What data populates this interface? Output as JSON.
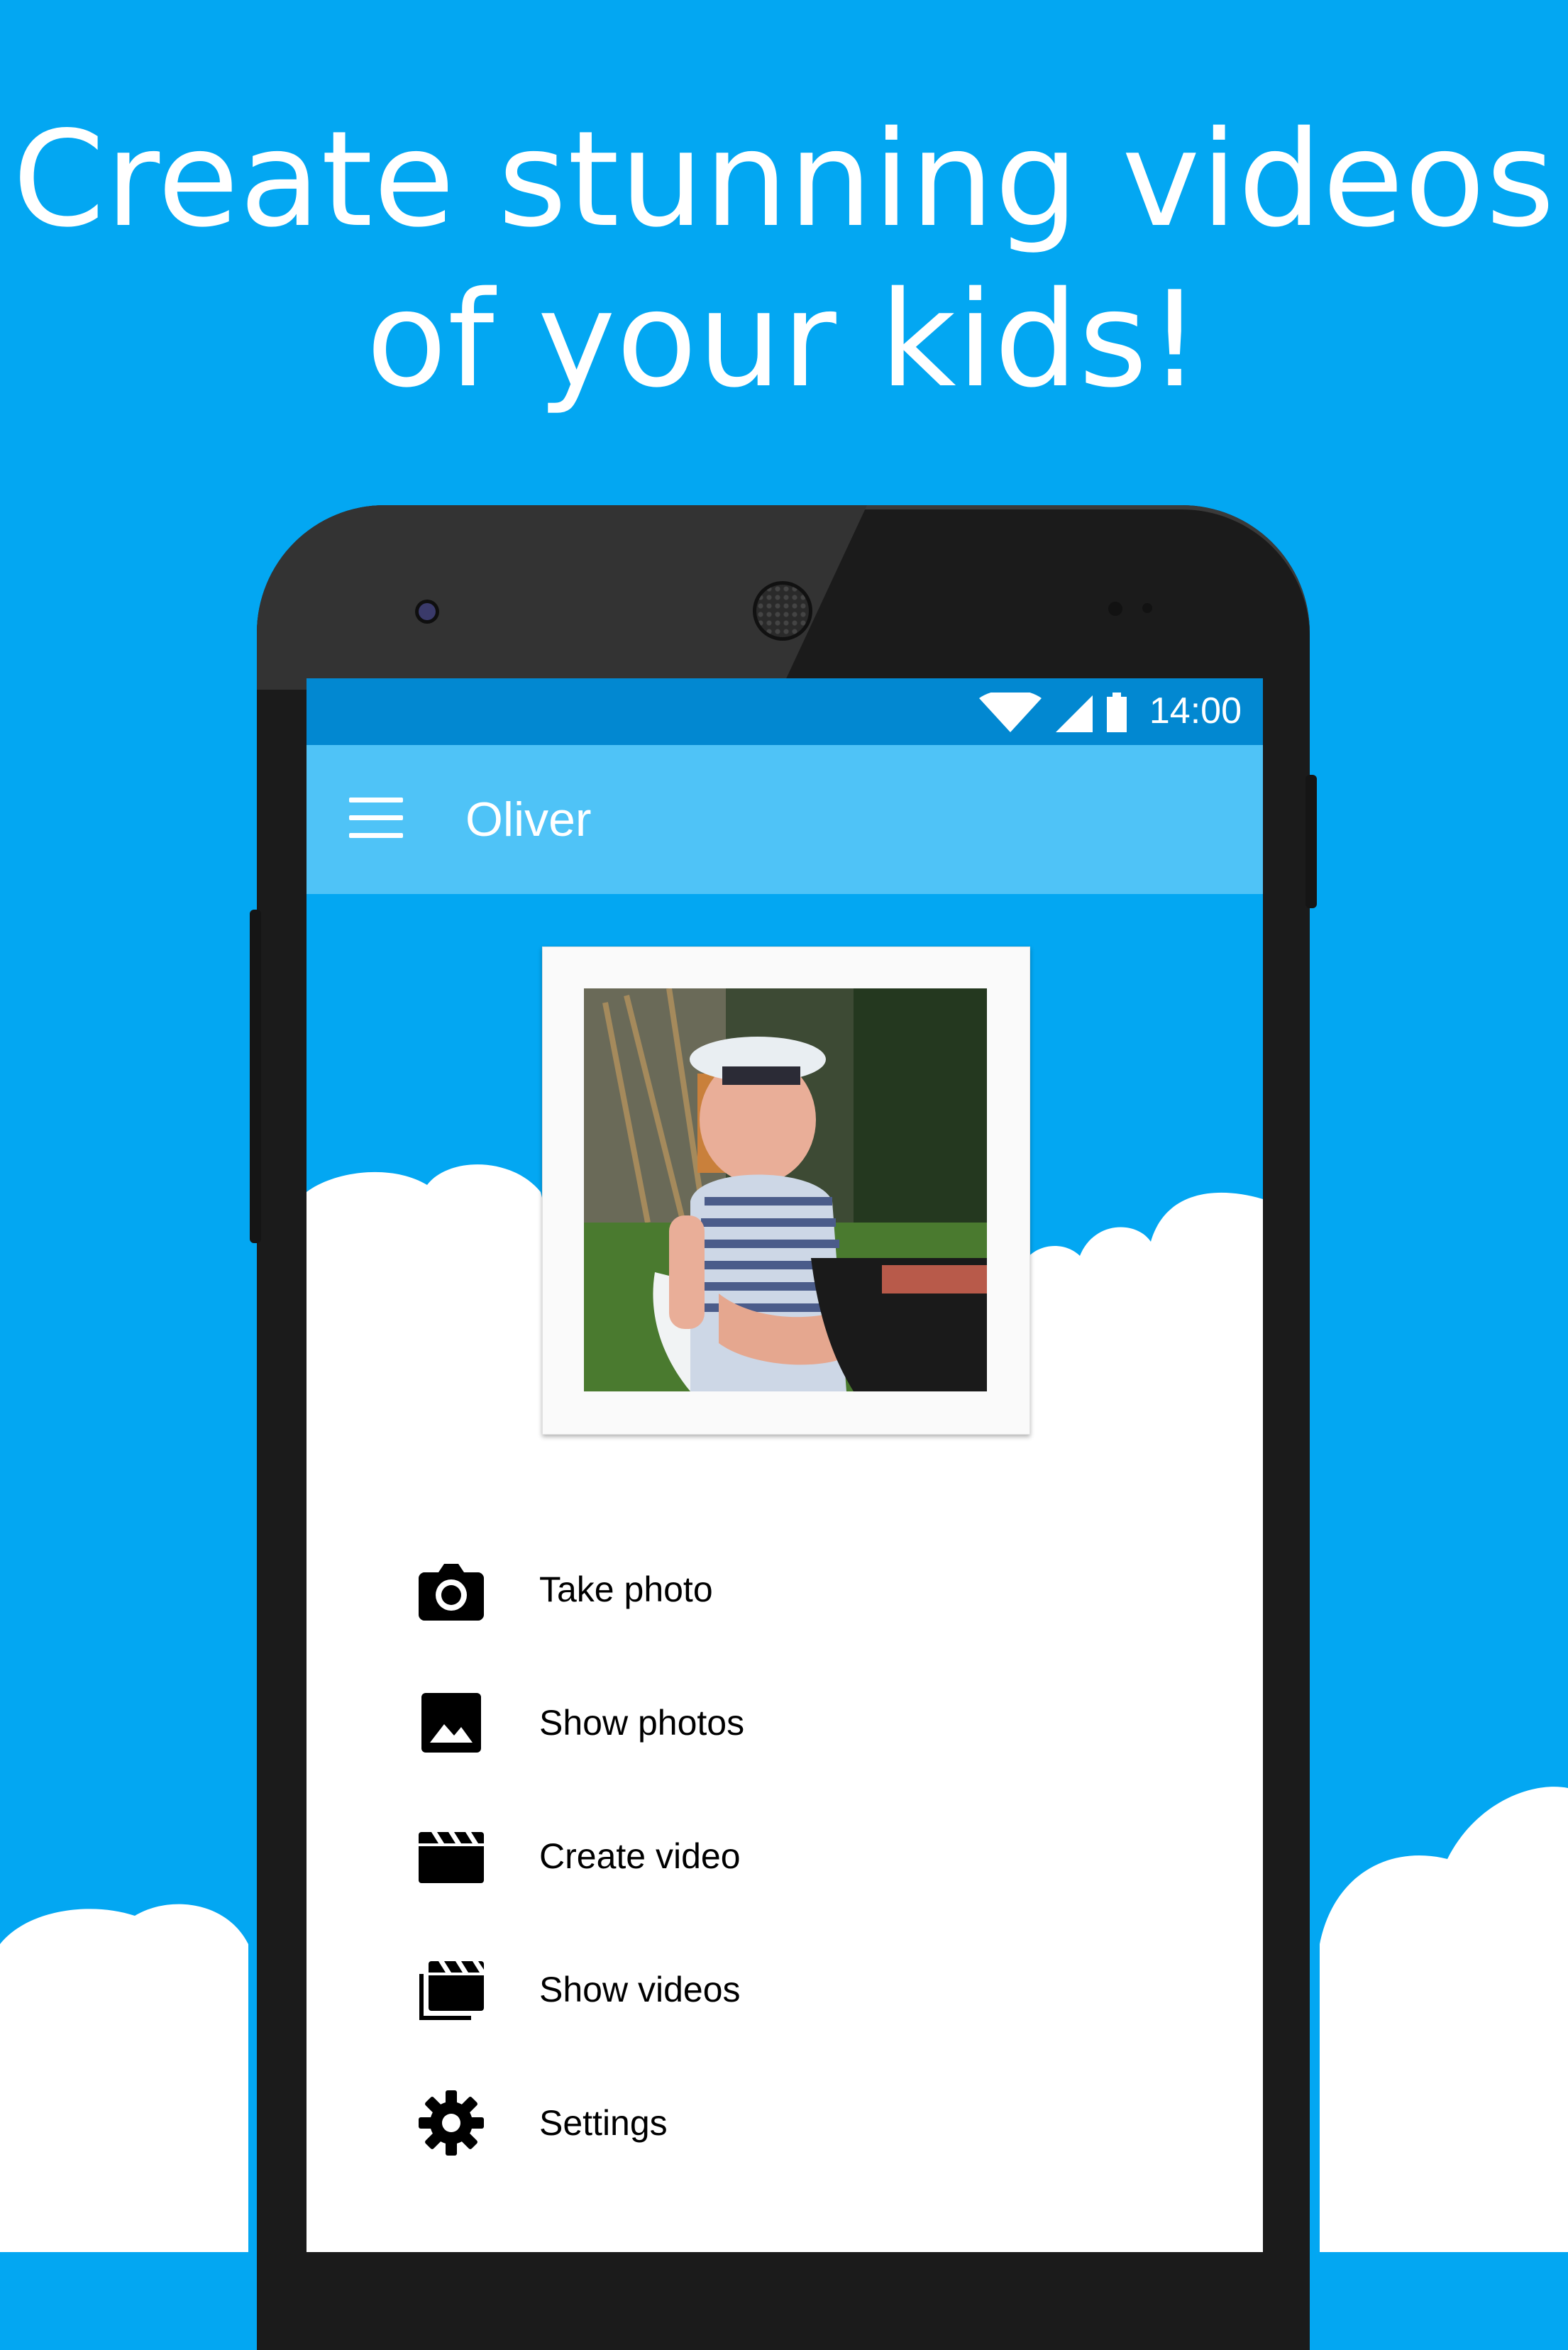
{
  "headline": {
    "line1": "Create stunning videos",
    "line2": "of your kids!"
  },
  "status_bar": {
    "time": "14:00",
    "icons": [
      "wifi-icon",
      "signal-icon",
      "battery-icon"
    ]
  },
  "toolbar": {
    "menu_icon": "menu-icon",
    "title": "Oliver"
  },
  "profile_photo": {
    "alt": "child photo"
  },
  "menu": {
    "items": [
      {
        "label": "Take photo",
        "icon": "camera-icon"
      },
      {
        "label": "Show photos",
        "icon": "image-icon"
      },
      {
        "label": "Create video",
        "icon": "clapperboard-icon"
      },
      {
        "label": "Show videos",
        "icon": "video-library-icon"
      },
      {
        "label": "Settings",
        "icon": "gear-icon"
      }
    ]
  },
  "colors": {
    "background": "#03A7F2",
    "status_bar": "#0288D1",
    "toolbar": "#4FC3F7",
    "phone_body": "#1b1b1b"
  }
}
